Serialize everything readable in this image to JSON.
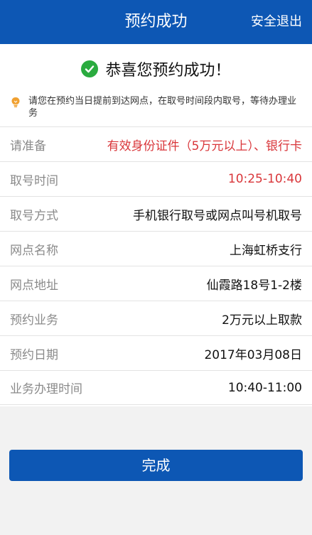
{
  "header": {
    "title": "预约成功",
    "action_label": "安全退出"
  },
  "success": {
    "message": "恭喜您预约成功！"
  },
  "notice": {
    "text": "请您在预约当日提前到达网点，在取号时间段内取号，等待办理业务"
  },
  "details": [
    {
      "label": "请准备",
      "value": "有效身份证件（5万元以上）、银行卡",
      "highlight": true
    },
    {
      "label": "取号时间",
      "value": "10:25-10:40",
      "highlight": true
    },
    {
      "label": "取号方式",
      "value": "手机银行取号或网点叫号机取号",
      "highlight": false
    },
    {
      "label": "网点名称",
      "value": "上海虹桥支行",
      "highlight": false
    },
    {
      "label": "网点地址",
      "value": "仙霞路18号1-2楼",
      "highlight": false
    },
    {
      "label": "预约业务",
      "value": "2万元以上取款",
      "highlight": false
    },
    {
      "label": "预约日期",
      "value": "2017年03月08日",
      "highlight": false
    },
    {
      "label": "业务办理时间",
      "value": "10:40-11:00",
      "highlight": false
    }
  ],
  "footer": {
    "done_label": "完成"
  },
  "colors": {
    "brand_blue": "#0d57b4",
    "success_green": "#2aab3f",
    "highlight_red": "#d9363a",
    "notice_orange": "#f0a030"
  },
  "icons": {
    "success": "check-circle-icon",
    "notice": "lightbulb-icon"
  }
}
